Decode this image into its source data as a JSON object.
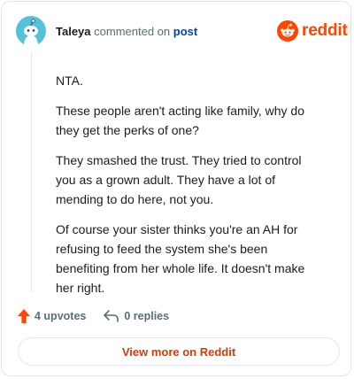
{
  "comment": {
    "author": "Taleya",
    "action_text": "commented on",
    "post_link_text": "post",
    "paragraphs": [
      "NTA.",
      "These people aren't acting like family, why do they get the perks of one?",
      "They smashed the trust. They tried to control you as a grown adult. They have a lot of mending to do here, not you.",
      "Of course your sister thinks you're an AH for refusing to feed the system she's been benefiting from her whole life. It doesn't make her right."
    ]
  },
  "branding": {
    "logo_word": "reddit",
    "brand_color": "#ff4500"
  },
  "stats": {
    "upvotes_label": "4 upvotes",
    "replies_label": "0 replies"
  },
  "footer": {
    "view_button_label": "View more on Reddit"
  },
  "colors": {
    "avatar_bg": "#54c3da",
    "upvote_icon": "#ff4500",
    "link": "#0045ac",
    "button_text": "#d93a00"
  },
  "icons": {
    "avatar": "snoo-avatar-icon",
    "logo": "reddit-snoo-logo-icon",
    "upvote": "upvote-arrow-icon",
    "reply": "reply-arrow-icon"
  }
}
